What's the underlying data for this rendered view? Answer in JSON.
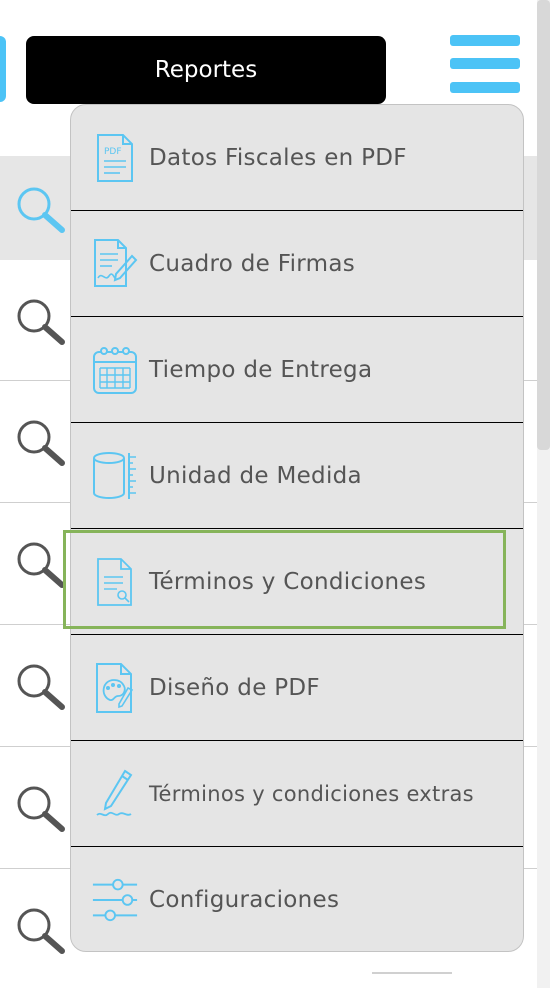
{
  "header": {
    "reportes_label": "Reportes"
  },
  "menu": {
    "items": [
      {
        "label": "Datos Fiscales en PDF",
        "icon": "pdf-document-icon"
      },
      {
        "label": "Cuadro de Firmas",
        "icon": "signature-document-icon"
      },
      {
        "label": "Tiempo de Entrega",
        "icon": "calendar-icon"
      },
      {
        "label": "Unidad de Medida",
        "icon": "cylinder-ruler-icon"
      },
      {
        "label": "Términos y Condiciones",
        "icon": "document-search-icon",
        "selected": true
      },
      {
        "label": "Diseño de PDF",
        "icon": "palette-document-icon"
      },
      {
        "label": "Términos y condiciones extras",
        "icon": "pen-icon"
      },
      {
        "label": "Configuraciones",
        "icon": "sliders-icon"
      }
    ]
  },
  "colors": {
    "accent": "#4cc3f6",
    "icon_stroke": "#5cc6f2",
    "menu_bg": "#e5e5e5",
    "selected_border": "#86b45a",
    "text": "#555555"
  }
}
